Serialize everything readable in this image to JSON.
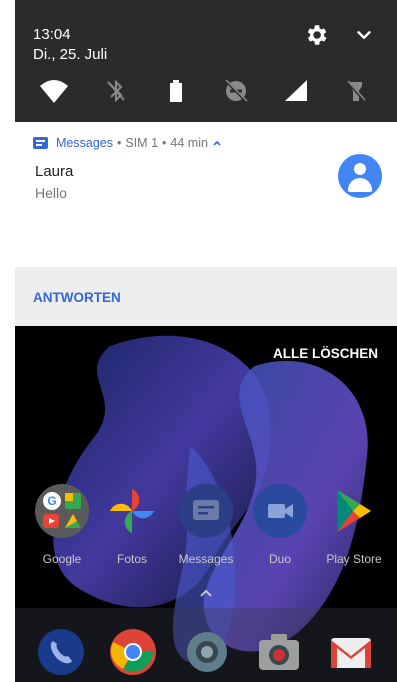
{
  "status": {
    "time": "13:04",
    "date": "Di., 25. Juli"
  },
  "notification": {
    "app_name": "Messages",
    "sim": "SIM 1",
    "age": "44 min",
    "sender": "Laura",
    "text": "Hello",
    "reply_action": "ANTWORTEN"
  },
  "shade": {
    "clear_all": "ALLE LÖSCHEN"
  },
  "home_apps": [
    {
      "label": "Google",
      "icon": "google-folder-icon"
    },
    {
      "label": "Fotos",
      "icon": "photos-pinwheel-icon"
    },
    {
      "label": "Messages",
      "icon": "messages-icon"
    },
    {
      "label": "Duo",
      "icon": "duo-camera-icon"
    },
    {
      "label": "Play Store",
      "icon": "play-store-icon"
    }
  ],
  "dock": [
    "phone-icon",
    "chrome-icon",
    "settings-gear-icon",
    "camera-icon",
    "gmail-icon"
  ],
  "colors": {
    "accent": "#3367d6",
    "shade_bg": "#2b2b2b",
    "reply_bg": "#eeeeee",
    "avatar": "#4285f4"
  }
}
